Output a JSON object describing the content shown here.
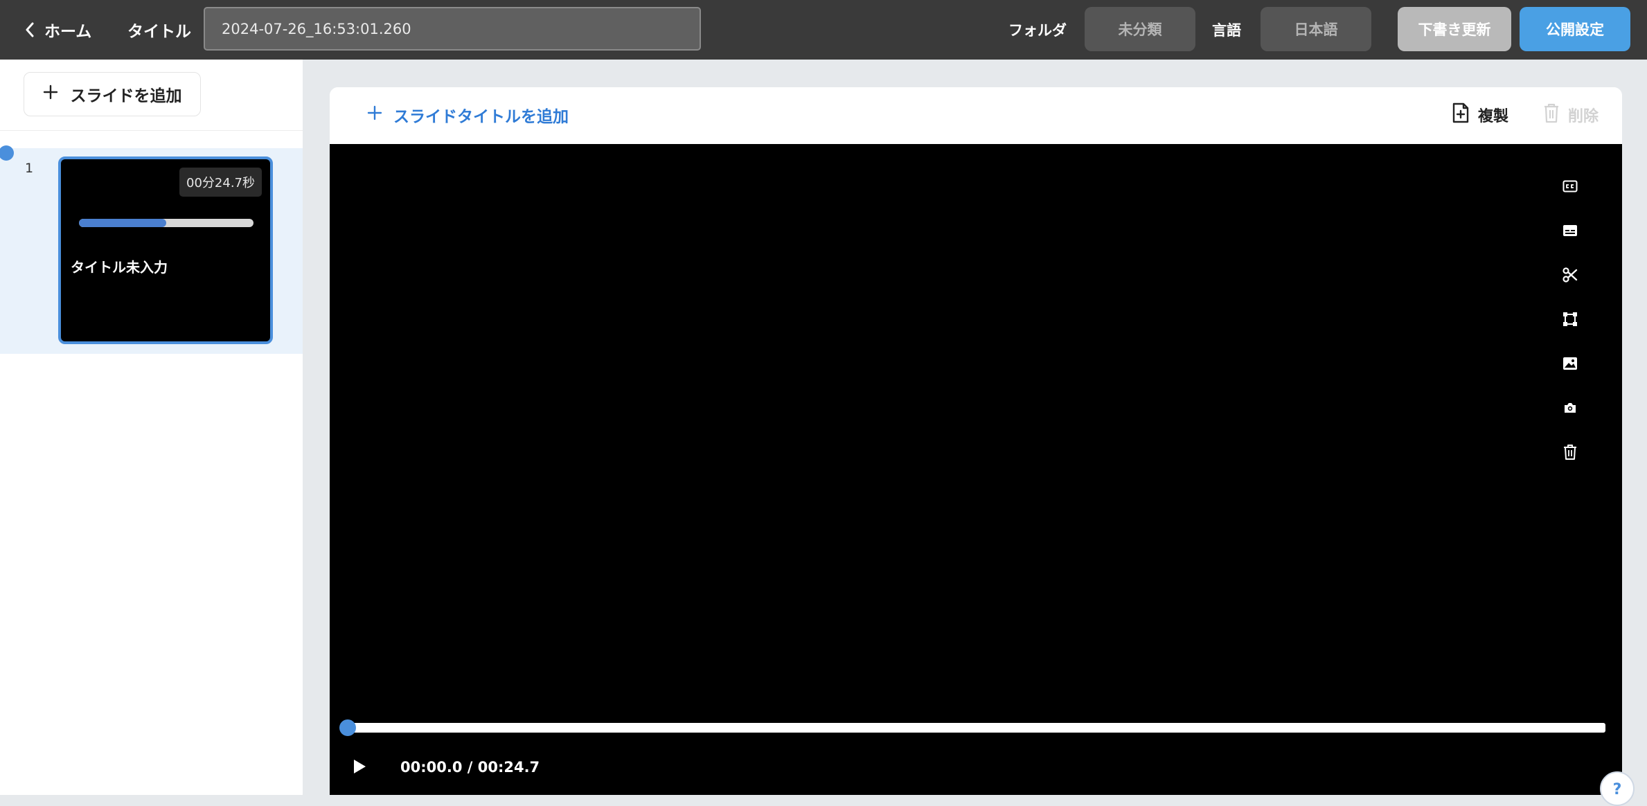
{
  "topbar": {
    "home_label": "ホーム",
    "title_label": "タイトル",
    "title_value": "2024-07-26_16:53:01.260",
    "folder_label": "フォルダ",
    "folder_value": "未分類",
    "language_label": "言語",
    "language_value": "日本語",
    "draft_update_label": "下書き更新",
    "publish_settings_label": "公開設定",
    "colors": {
      "bar": "#3a3a3a",
      "publish_button": "#4aa0e4",
      "draft_button": "#b9b9b9"
    }
  },
  "sidebar": {
    "add_slide_label": "スライドを追加",
    "slides": [
      {
        "number": "1",
        "duration": "00分24.7秒",
        "title": "タイトル未入力",
        "progress": 0.5,
        "selected": true
      }
    ]
  },
  "editor": {
    "add_title_label": "スライドタイトルを追加",
    "duplicate_label": "複製",
    "delete_label": "削除",
    "tools": [
      "closed-caption-icon",
      "subtitles-icon",
      "scissors-icon",
      "resize-frame-icon",
      "image-icon",
      "camera-icon",
      "trash-icon"
    ],
    "player": {
      "current_time": "00:00.0",
      "separator": " / ",
      "total_time": "00:24.7",
      "progress": 0
    }
  },
  "help": {
    "label": "?"
  },
  "accent_color": "#4a8fdc"
}
